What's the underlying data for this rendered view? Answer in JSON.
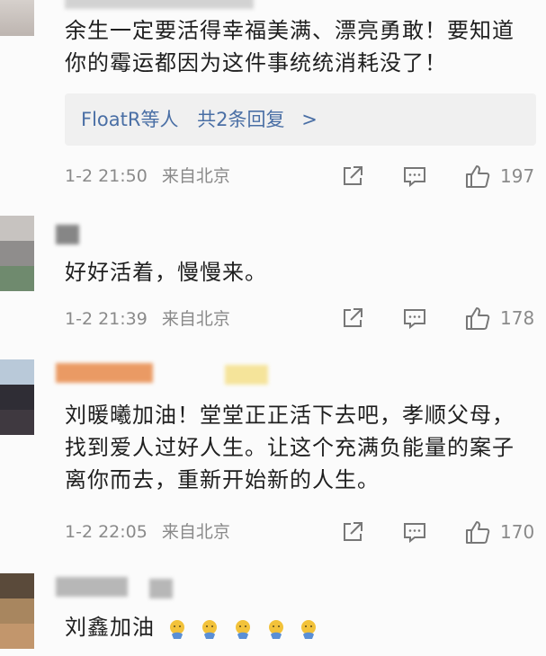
{
  "comments": [
    {
      "text": "余生一定要活得幸福美满、漂亮勇敢！要知道你的霉运都因为这件事统统消耗没了！",
      "reply_names": "FloatR等人",
      "reply_count": "共2条回复",
      "reply_chevron": ">",
      "time": "1-2 21:50",
      "location": "来自北京",
      "likes": "197"
    },
    {
      "text": "好好活着，慢慢来。",
      "time": "1-2 21:39",
      "location": "来自北京",
      "likes": "178"
    },
    {
      "text": "刘暖曦加油！堂堂正正活下去吧，孝顺父母，找到爱人过好人生。让这个充满负能量的案子离你而去，重新开始新的人生。",
      "time": "1-2 22:05",
      "location": "来自北京",
      "likes": "170"
    },
    {
      "text": "刘鑫加油",
      "emoji_name": "praying-emoji",
      "emoji_count": 5
    }
  ],
  "colors": {
    "link": "#4a6fa5",
    "meta": "#8a8a8a",
    "reply_bg": "#f0f0f0",
    "emoji": "#f2c23a",
    "emoji_accent": "#5a8fd6"
  },
  "icons": [
    "share-icon",
    "comment-icon",
    "like-icon",
    "praying-emoji"
  ]
}
